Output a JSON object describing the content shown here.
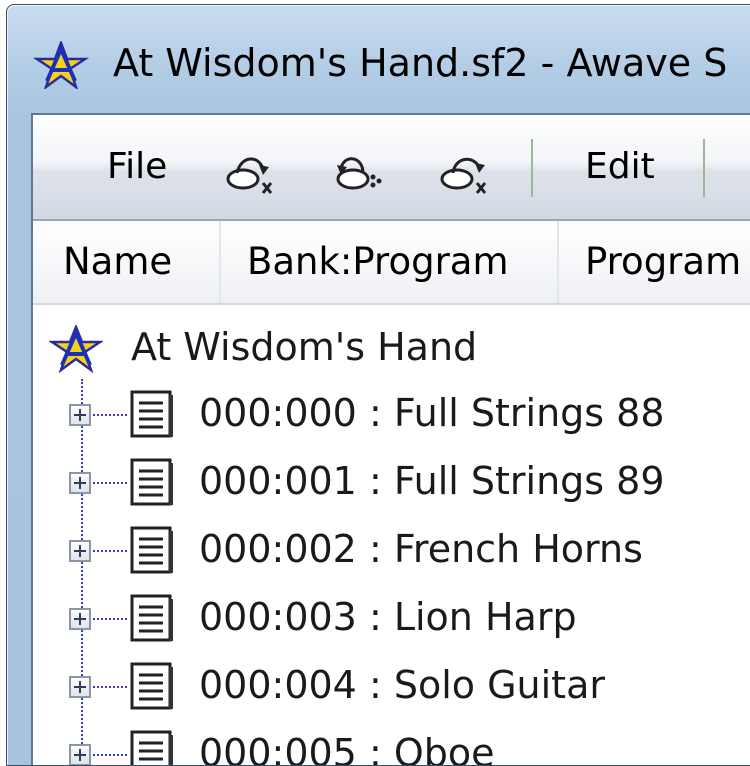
{
  "window": {
    "title": "At Wisdom's Hand.sf2 - Awave S"
  },
  "menubar": {
    "file_label": "File",
    "edit_label": "Edit",
    "tool_icons": [
      "undo-icon",
      "redo-icon",
      "cut-icon"
    ]
  },
  "columns": {
    "name": "Name",
    "bank_program": "Bank:Program",
    "program": "Program"
  },
  "tree": {
    "root_label": "At Wisdom's Hand",
    "items": [
      {
        "label": "000:000 : Full Strings 88"
      },
      {
        "label": "000:001 : Full Strings 89"
      },
      {
        "label": "000:002 : French Horns"
      },
      {
        "label": "000:003 : Lion Harp"
      },
      {
        "label": "000:004 : Solo Guitar"
      },
      {
        "label": "000:005 : Oboe"
      }
    ]
  },
  "colors": {
    "title_bar": "#b4cde6",
    "tree_lines": "#3a3ad0",
    "menu_separator": "#98b898"
  }
}
